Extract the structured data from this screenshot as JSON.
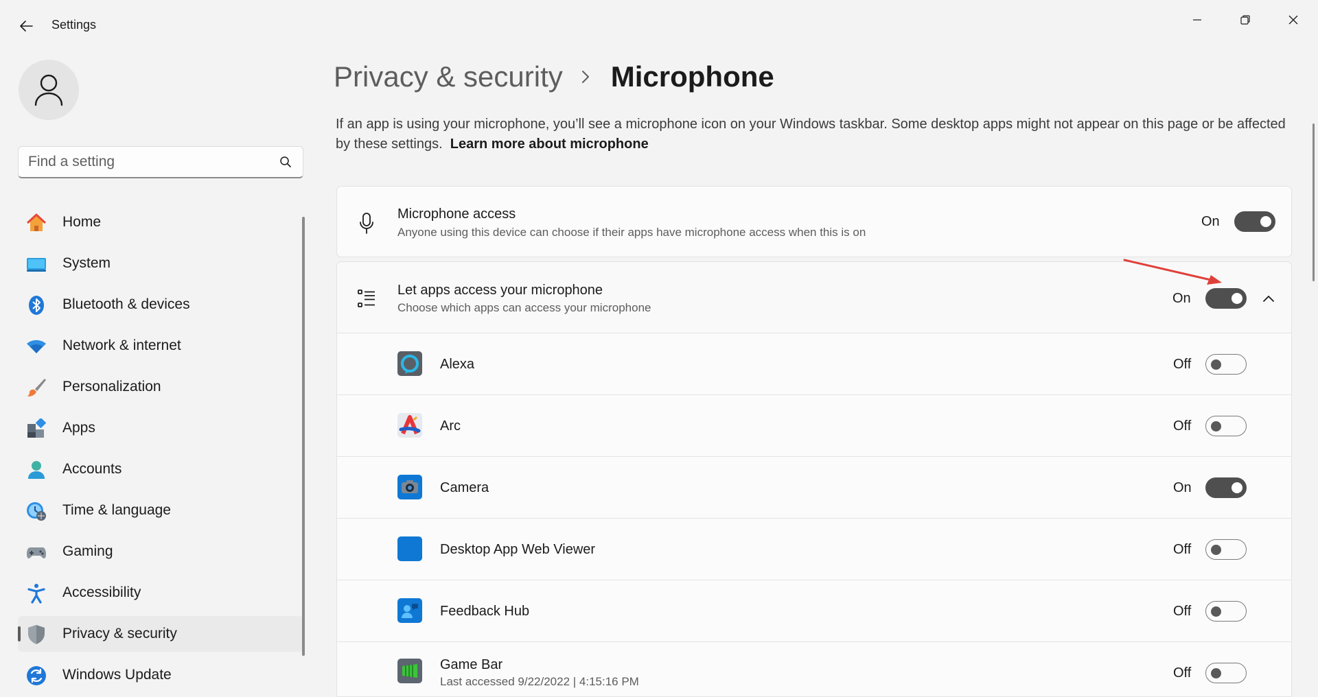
{
  "window": {
    "title": "Settings"
  },
  "search": {
    "placeholder": "Find a setting"
  },
  "sidebar": {
    "items": [
      {
        "label": "Home",
        "icon": "home-icon"
      },
      {
        "label": "System",
        "icon": "system-icon"
      },
      {
        "label": "Bluetooth & devices",
        "icon": "bluetooth-icon"
      },
      {
        "label": "Network & internet",
        "icon": "wifi-icon"
      },
      {
        "label": "Personalization",
        "icon": "brush-icon"
      },
      {
        "label": "Apps",
        "icon": "apps-icon"
      },
      {
        "label": "Accounts",
        "icon": "accounts-icon"
      },
      {
        "label": "Time & language",
        "icon": "clock-globe-icon"
      },
      {
        "label": "Gaming",
        "icon": "gamepad-icon"
      },
      {
        "label": "Accessibility",
        "icon": "accessibility-icon"
      },
      {
        "label": "Privacy & security",
        "icon": "shield-icon",
        "selected": true
      },
      {
        "label": "Windows Update",
        "icon": "update-icon"
      }
    ]
  },
  "breadcrumb": {
    "parent": "Privacy & security",
    "current": "Microphone"
  },
  "description": {
    "text": "If an app is using your microphone, you’ll see a microphone icon on your Windows taskbar. Some desktop apps might not appear on this page or be affected by these settings.",
    "link": "Learn more about microphone"
  },
  "microphone_access": {
    "title": "Microphone access",
    "subtitle": "Anyone using this device can choose if their apps have microphone access when this is on",
    "state": "On",
    "on": true,
    "icon": "microphone-icon"
  },
  "let_apps": {
    "title": "Let apps access your microphone",
    "subtitle": "Choose which apps can access your microphone",
    "state": "On",
    "on": true,
    "icon": "list-icon",
    "expanded": true
  },
  "apps": [
    {
      "name": "Alexa",
      "state": "Off",
      "on": false,
      "meta": "",
      "icon": "alexa-icon"
    },
    {
      "name": "Arc",
      "state": "Off",
      "on": false,
      "meta": "",
      "icon": "arc-icon"
    },
    {
      "name": "Camera",
      "state": "On",
      "on": true,
      "meta": "",
      "icon": "camera-icon"
    },
    {
      "name": "Desktop App Web Viewer",
      "state": "Off",
      "on": false,
      "meta": "",
      "icon": "webviewer-icon"
    },
    {
      "name": "Feedback Hub",
      "state": "Off",
      "on": false,
      "meta": "",
      "icon": "feedback-hub-icon"
    },
    {
      "name": "Game Bar",
      "state": "Off",
      "on": false,
      "meta": "Last accessed 9/22/2022  |  4:15:16 PM",
      "icon": "game-bar-icon"
    }
  ],
  "colors": {
    "background": "#f3f3f3",
    "card": "#fbfbfb",
    "toggle_on": "#4f4f4f",
    "annotation_arrow": "#e0403a",
    "windows_blue": "#0f78d4"
  }
}
